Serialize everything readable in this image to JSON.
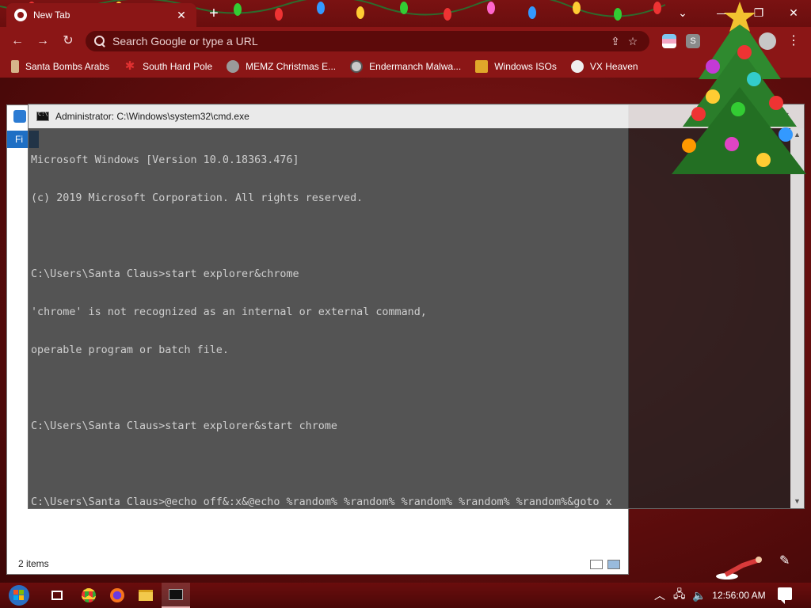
{
  "browser": {
    "tab_title": "New Tab",
    "tab_close": "✕",
    "new_tab": "+",
    "window_controls": {
      "minimize": "—",
      "maximize": "❐",
      "close": "✕",
      "tab_search": "⌄"
    },
    "omnibox_placeholder": "Search Google or type a URL",
    "nav": {
      "back": "←",
      "forward": "→",
      "reload": "↻"
    },
    "actions": {
      "share": "⇪",
      "bookmark": "☆",
      "menu": "⋮"
    },
    "extensions": [
      {
        "name": "flag-extension",
        "color": "#f4a6c4"
      },
      {
        "name": "s-extension",
        "color": "#9a9a9a",
        "label": "S"
      },
      {
        "name": "puzzle-extension",
        "color": "#d9d9d9"
      }
    ]
  },
  "bookmarks": [
    {
      "label": "Santa Bombs Arabs",
      "icon": "figure-icon",
      "color": "#d6b48b"
    },
    {
      "label": "South Hard Pole",
      "icon": "snowflake-icon",
      "color": "#d92b2b"
    },
    {
      "label": "MEMZ Christmas E...",
      "icon": "globe-icon",
      "color": "#9a9a9a"
    },
    {
      "label": "Endermanch Malwa...",
      "icon": "raccoon-icon",
      "color": "#c9c9c9"
    },
    {
      "label": "Windows ISOs",
      "icon": "trophy-icon",
      "color": "#e0a72a"
    },
    {
      "label": "VX Heaven",
      "icon": "skull-icon",
      "color": "#efefef"
    }
  ],
  "explorer": {
    "ribbon_tab": "Fi",
    "status": "2 items"
  },
  "cmd": {
    "title": "Administrator: C:\\Windows\\system32\\cmd.exe",
    "lines": [
      "Microsoft Windows [Version 10.0.18363.476]",
      "(c) 2019 Microsoft Corporation. All rights reserved.",
      "",
      "C:\\Users\\Santa Claus>start explorer&chrome",
      "'chrome' is not recognized as an internal or external command,",
      "operable program or batch file.",
      "",
      "C:\\Users\\Santa Claus>start explorer&start chrome",
      "",
      "C:\\Users\\Santa Claus>@echo off&:x&@echo %random% %random% %random% %random% %random%&goto x"
    ],
    "controls": {
      "minimize": "—",
      "maximize": "☐",
      "close": "✕"
    },
    "scroll_up": "▲",
    "scroll_down": "▼"
  },
  "taskbar": {
    "clock": "12:56:00 AM",
    "tray": {
      "chevron": "︿",
      "network": "🖧",
      "volume": "🔈"
    }
  },
  "colors": {
    "accent": "#8b1616",
    "titlebar": "#7a1212",
    "cmd_background": "#242424",
    "cmd_text": "#cfcfcf"
  }
}
